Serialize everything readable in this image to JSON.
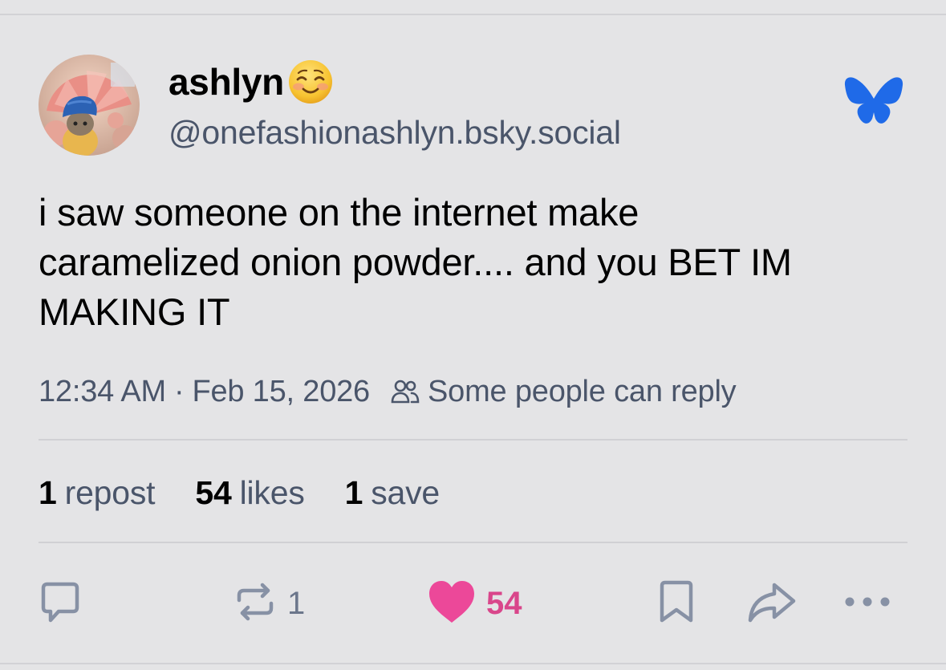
{
  "author": {
    "display_name": "ashlyn",
    "emoji": "smiling-face-with-blush",
    "handle": "@onefashionashlyn.bsky.social"
  },
  "logo": "bluesky-butterfly",
  "post": {
    "text": "i saw someone on the internet make\ncaramelized onion powder.... and you BET IM\nMAKING IT"
  },
  "meta": {
    "time": "12:34 AM",
    "separator": "·",
    "date": "Feb 15, 2026",
    "reply_setting": "Some people can reply"
  },
  "stats": {
    "reposts_count": "1",
    "reposts_label": "repost",
    "likes_count": "54",
    "likes_label": "likes",
    "saves_count": "1",
    "saves_label": "save"
  },
  "actions": {
    "reply_icon": "speech-bubble-icon",
    "repost_icon": "repost-arrows-icon",
    "repost_count": "1",
    "like_icon": "heart-icon",
    "like_count": "54",
    "bookmark_icon": "bookmark-icon",
    "share_icon": "share-arrow-icon",
    "more_icon": "ellipsis-icon"
  },
  "colors": {
    "background": "#e4e4e6",
    "secondary_text": "#4a556a",
    "like_pink": "#ec4899",
    "bluesky_blue": "#1f6ae8",
    "divider": "#d0d0d4"
  }
}
